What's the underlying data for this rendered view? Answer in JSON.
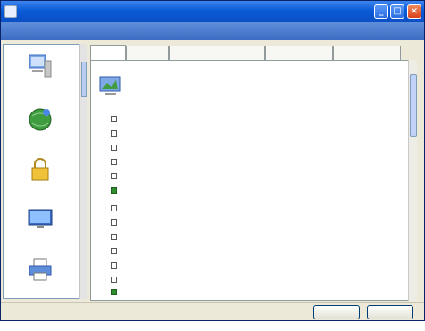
{
  "window": {
    "title": ""
  },
  "header": {
    "left_text": "",
    "right_text": ""
  },
  "sidebar": {
    "items": [
      {
        "label": "",
        "icon": "computer-icon"
      },
      {
        "label": "",
        "icon": "globe-icon"
      },
      {
        "label": "",
        "icon": "lock-icon"
      },
      {
        "label": "",
        "icon": "monitor-icon"
      },
      {
        "label": "",
        "icon": "printer-icon"
      }
    ]
  },
  "tabs": [
    "",
    "",
    "",
    "",
    ""
  ],
  "content": {
    "section_title": "",
    "more_link": "",
    "items": [
      "",
      "",
      "",
      "",
      "",
      "",
      "",
      "",
      "",
      "",
      "",
      "",
      ""
    ]
  },
  "status": {
    "left": "",
    "right": ""
  },
  "buttons": {
    "first": "",
    "second": ""
  },
  "colors": {
    "title_bar": "#0a5ad8",
    "header_bar": "#3b6cc2",
    "window_bg": "#ece9d8"
  }
}
